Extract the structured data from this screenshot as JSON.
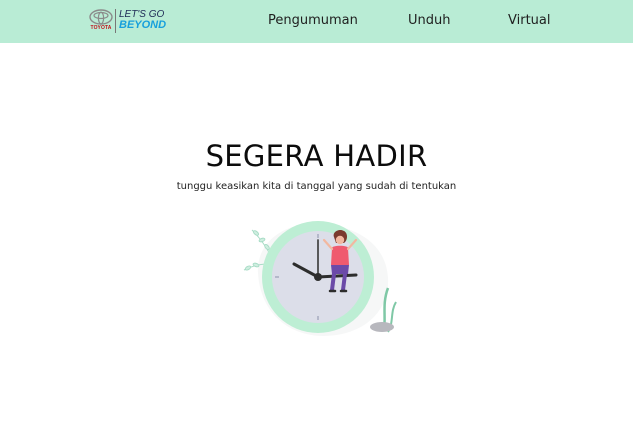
{
  "header": {
    "logo": {
      "brand": "TOYOTA",
      "tagline_line1": "LET'S GO",
      "tagline_line2": "BEYOND"
    },
    "nav": [
      {
        "label": "Pengumuman"
      },
      {
        "label": "Unduh"
      },
      {
        "label": "Virtual"
      }
    ]
  },
  "main": {
    "headline": "SEGERA HADIR",
    "subtext": "tunggu keasikan kita di tanggal yang sudah di tentukan",
    "illustration_icon": "clock-waiting-woman-illustration"
  },
  "colors": {
    "navbar_bg": "#b9ecd5",
    "accent_mint": "#bdeed4",
    "brand_red": "#c0101a",
    "brand_blue": "#17a0dc"
  }
}
